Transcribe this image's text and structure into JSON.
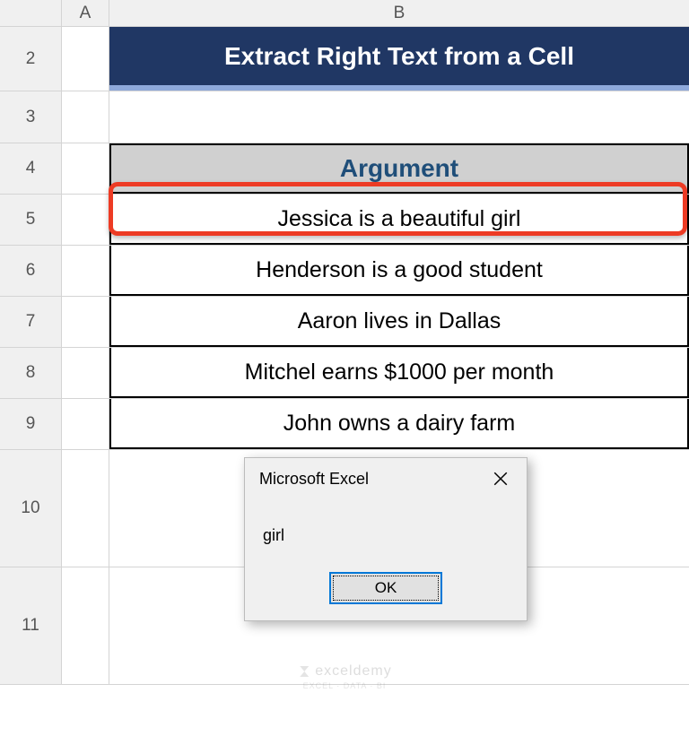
{
  "columns": {
    "A": "A",
    "B": "B"
  },
  "rows": [
    "2",
    "3",
    "4",
    "5",
    "6",
    "7",
    "8",
    "9",
    "10",
    "11"
  ],
  "title": "Extract Right Text from a Cell",
  "table": {
    "header": "Argument",
    "rows": [
      "Jessica is a beautiful girl",
      "Henderson is a good student",
      "Aaron lives in Dallas",
      "Mitchel earns $1000 per month",
      "John owns a dairy farm"
    ],
    "highlighted_index": 0
  },
  "dialog": {
    "title": "Microsoft Excel",
    "message": "girl",
    "ok_label": "OK"
  },
  "watermark": {
    "brand": "exceldemy",
    "tag": "EXCEL · DATA · BI"
  }
}
